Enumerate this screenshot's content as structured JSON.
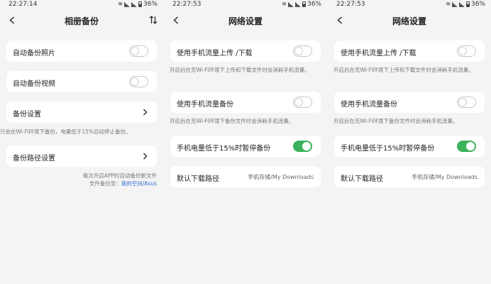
{
  "screens": [
    {
      "status": {
        "time": "22:27:14",
        "battery": "36%"
      },
      "title": "相册备份",
      "items": [
        {
          "label": "自动备份照片"
        },
        {
          "label": "自动备份视频"
        },
        {
          "label": "备份设置"
        },
        {
          "label": "备份路径设置"
        }
      ],
      "note": "只会在Wi-Fi环境下备份，电量低于15%自动停止备份。",
      "footer_line1": "每次开启APP时自动备份新文件",
      "footer_line2_prefix": "文件备份至：",
      "footer_link": "我的空间/Asus"
    },
    {
      "status": {
        "time": "22:27:53",
        "battery": "36%"
      },
      "title": "网络设置",
      "items": [
        {
          "label": "使用手机流量上传 /下载",
          "note": "开启后在无Wi-Fi环境下上传和下载文件时会消耗手机流量。"
        },
        {
          "label": "使用手机流量备份",
          "note": "开启后在无Wi-Fi环境下备份文件时会消耗手机流量。"
        },
        {
          "label": "手机电量低于15%时暂停备份"
        },
        {
          "label": "默认下载路径",
          "value": "手机存储/My Downloads"
        }
      ]
    },
    {
      "status": {
        "time": "22:27:53",
        "battery": "36%"
      },
      "title": "网络设置",
      "items": [
        {
          "label": "使用手机流量上传 /下载",
          "note": "开启后在无Wi-Fi环境下上传和下载文件时会消耗手机流量。"
        },
        {
          "label": "使用手机流量备份",
          "note": "开启后在无Wi-Fi环境下备份文件时会消耗手机流量。"
        },
        {
          "label": "手机电量低于15%时暂停备份"
        },
        {
          "label": "默认下载路径",
          "value": "手机存储/My Downloads"
        }
      ]
    }
  ],
  "icons": {
    "back": "chevron-left-icon",
    "sort": "sort-icon",
    "chevron": "chevron-right-icon"
  },
  "colors": {
    "toggle_on": "#3bb159",
    "link": "#2f6fd6",
    "background": "#f4f4f4"
  }
}
